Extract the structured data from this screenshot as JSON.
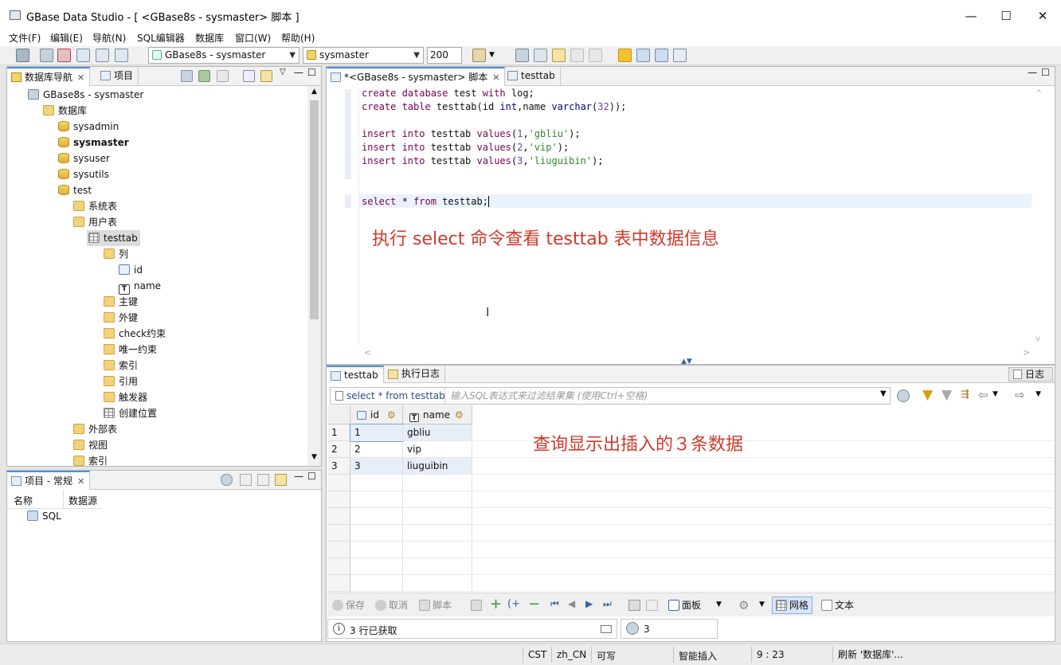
{
  "window": {
    "title": "GBase Data Studio - [ <GBase8s - sysmaster> 脚本 ]",
    "minimize": "—",
    "maximize": "☐",
    "close": "✕"
  },
  "menu": [
    "文件(F)",
    "编辑(E)",
    "导航(N)",
    "SQL编辑器",
    "数据库",
    "窗口(W)",
    "帮助(H)"
  ],
  "toolbar": {
    "connection": "GBase8s - sysmaster",
    "database": "sysmaster",
    "limit": "200"
  },
  "navigator": {
    "tab_db": "数据库导航",
    "tab_project": "项目",
    "tree": [
      {
        "label": "GBase8s - sysmaster",
        "icon": "server-icon",
        "indent": 0
      },
      {
        "label": "数据库",
        "icon": "folder-icon",
        "indent": 1
      },
      {
        "label": "sysadmin",
        "icon": "database-icon",
        "indent": 2
      },
      {
        "label": "sysmaster",
        "icon": "database-icon",
        "indent": 2,
        "bold": true
      },
      {
        "label": "sysuser",
        "icon": "database-icon",
        "indent": 2
      },
      {
        "label": "sysutils",
        "icon": "database-icon",
        "indent": 2
      },
      {
        "label": "test",
        "icon": "database-icon",
        "indent": 2
      },
      {
        "label": "系统表",
        "icon": "folder-icon",
        "indent": 3
      },
      {
        "label": "用户表",
        "icon": "folder-icon",
        "indent": 3
      },
      {
        "label": "testtab",
        "icon": "table-icon",
        "indent": 4,
        "selected": true
      },
      {
        "label": "列",
        "icon": "folder-icon",
        "indent": 5
      },
      {
        "label": "id",
        "icon": "column-icon",
        "indent": 6
      },
      {
        "label": "name",
        "icon": "text-column-icon",
        "indent": 6
      },
      {
        "label": "主键",
        "icon": "folder-icon",
        "indent": 5
      },
      {
        "label": "外键",
        "icon": "folder-icon",
        "indent": 5
      },
      {
        "label": "check约束",
        "icon": "folder-icon",
        "indent": 5
      },
      {
        "label": "唯一约束",
        "icon": "folder-icon",
        "indent": 5
      },
      {
        "label": "索引",
        "icon": "folder-icon",
        "indent": 5
      },
      {
        "label": "引用",
        "icon": "folder-icon",
        "indent": 5
      },
      {
        "label": "触发器",
        "icon": "folder-icon",
        "indent": 5
      },
      {
        "label": "创建位置",
        "icon": "table-icon",
        "indent": 5
      },
      {
        "label": "外部表",
        "icon": "folder-icon",
        "indent": 3
      },
      {
        "label": "视图",
        "icon": "folder-icon",
        "indent": 3
      },
      {
        "label": "索引",
        "icon": "folder-icon",
        "indent": 3
      }
    ]
  },
  "project_panel": {
    "tab": "项目 - 常规",
    "col_name": "名称",
    "col_source": "数据源",
    "item": "SQL"
  },
  "editor": {
    "tab_script": "*<GBase8s - sysmaster> 脚本",
    "tab_table": "testtab",
    "annotation": "执行 select 命令查看 testtab 表中数据信息"
  },
  "results": {
    "tab_result": "testtab",
    "tab_log": "执行日志",
    "log_button": "日志",
    "query_label": "select * from testtab",
    "filter_placeholder": "输入SQL表达式来过滤结果集 (使用Ctrl+空格)",
    "columns": [
      "id",
      "name"
    ],
    "rows": [
      [
        "1",
        "1",
        "gbliu"
      ],
      [
        "2",
        "2",
        "vip"
      ],
      [
        "3",
        "3",
        "liuguibin"
      ]
    ],
    "annotation": "查询显示出插入的３条数据",
    "save": "保存",
    "cancel": "取消",
    "script": "脚本",
    "panel": "面板",
    "grid": "网格",
    "text": "文本",
    "fetched": "3 行已获取",
    "refresh_count": "3"
  },
  "status": {
    "tz": "CST",
    "locale": "zh_CN",
    "writable": "可写",
    "insert_mode": "智能插入",
    "cursor": "9 : 23",
    "message": "刷新 '数据库'..."
  }
}
